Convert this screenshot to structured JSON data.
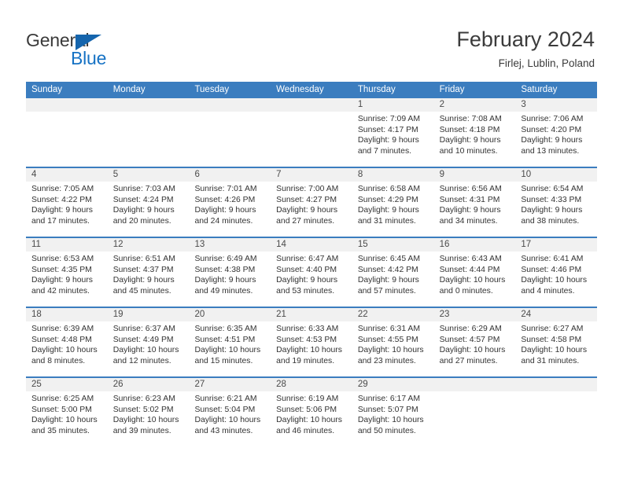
{
  "brand": {
    "name_top": "General",
    "name_bottom": "Blue",
    "accent_color": "#1672c4",
    "triangle_color": "#1565ad"
  },
  "header": {
    "title": "February 2024",
    "subtitle": "Firlej, Lublin, Poland"
  },
  "theme": {
    "header_blue": "#3b7dbf",
    "day_band_gray": "#f1f1f1",
    "text_color": "#333333"
  },
  "weekdays": [
    "Sunday",
    "Monday",
    "Tuesday",
    "Wednesday",
    "Thursday",
    "Friday",
    "Saturday"
  ],
  "weeks": [
    [
      {
        "day": "",
        "lines": []
      },
      {
        "day": "",
        "lines": []
      },
      {
        "day": "",
        "lines": []
      },
      {
        "day": "",
        "lines": []
      },
      {
        "day": "1",
        "lines": [
          "Sunrise: 7:09 AM",
          "Sunset: 4:17 PM",
          "Daylight: 9 hours",
          "and 7 minutes."
        ]
      },
      {
        "day": "2",
        "lines": [
          "Sunrise: 7:08 AM",
          "Sunset: 4:18 PM",
          "Daylight: 9 hours",
          "and 10 minutes."
        ]
      },
      {
        "day": "3",
        "lines": [
          "Sunrise: 7:06 AM",
          "Sunset: 4:20 PM",
          "Daylight: 9 hours",
          "and 13 minutes."
        ]
      }
    ],
    [
      {
        "day": "4",
        "lines": [
          "Sunrise: 7:05 AM",
          "Sunset: 4:22 PM",
          "Daylight: 9 hours",
          "and 17 minutes."
        ]
      },
      {
        "day": "5",
        "lines": [
          "Sunrise: 7:03 AM",
          "Sunset: 4:24 PM",
          "Daylight: 9 hours",
          "and 20 minutes."
        ]
      },
      {
        "day": "6",
        "lines": [
          "Sunrise: 7:01 AM",
          "Sunset: 4:26 PM",
          "Daylight: 9 hours",
          "and 24 minutes."
        ]
      },
      {
        "day": "7",
        "lines": [
          "Sunrise: 7:00 AM",
          "Sunset: 4:27 PM",
          "Daylight: 9 hours",
          "and 27 minutes."
        ]
      },
      {
        "day": "8",
        "lines": [
          "Sunrise: 6:58 AM",
          "Sunset: 4:29 PM",
          "Daylight: 9 hours",
          "and 31 minutes."
        ]
      },
      {
        "day": "9",
        "lines": [
          "Sunrise: 6:56 AM",
          "Sunset: 4:31 PM",
          "Daylight: 9 hours",
          "and 34 minutes."
        ]
      },
      {
        "day": "10",
        "lines": [
          "Sunrise: 6:54 AM",
          "Sunset: 4:33 PM",
          "Daylight: 9 hours",
          "and 38 minutes."
        ]
      }
    ],
    [
      {
        "day": "11",
        "lines": [
          "Sunrise: 6:53 AM",
          "Sunset: 4:35 PM",
          "Daylight: 9 hours",
          "and 42 minutes."
        ]
      },
      {
        "day": "12",
        "lines": [
          "Sunrise: 6:51 AM",
          "Sunset: 4:37 PM",
          "Daylight: 9 hours",
          "and 45 minutes."
        ]
      },
      {
        "day": "13",
        "lines": [
          "Sunrise: 6:49 AM",
          "Sunset: 4:38 PM",
          "Daylight: 9 hours",
          "and 49 minutes."
        ]
      },
      {
        "day": "14",
        "lines": [
          "Sunrise: 6:47 AM",
          "Sunset: 4:40 PM",
          "Daylight: 9 hours",
          "and 53 minutes."
        ]
      },
      {
        "day": "15",
        "lines": [
          "Sunrise: 6:45 AM",
          "Sunset: 4:42 PM",
          "Daylight: 9 hours",
          "and 57 minutes."
        ]
      },
      {
        "day": "16",
        "lines": [
          "Sunrise: 6:43 AM",
          "Sunset: 4:44 PM",
          "Daylight: 10 hours",
          "and 0 minutes."
        ]
      },
      {
        "day": "17",
        "lines": [
          "Sunrise: 6:41 AM",
          "Sunset: 4:46 PM",
          "Daylight: 10 hours",
          "and 4 minutes."
        ]
      }
    ],
    [
      {
        "day": "18",
        "lines": [
          "Sunrise: 6:39 AM",
          "Sunset: 4:48 PM",
          "Daylight: 10 hours",
          "and 8 minutes."
        ]
      },
      {
        "day": "19",
        "lines": [
          "Sunrise: 6:37 AM",
          "Sunset: 4:49 PM",
          "Daylight: 10 hours",
          "and 12 minutes."
        ]
      },
      {
        "day": "20",
        "lines": [
          "Sunrise: 6:35 AM",
          "Sunset: 4:51 PM",
          "Daylight: 10 hours",
          "and 15 minutes."
        ]
      },
      {
        "day": "21",
        "lines": [
          "Sunrise: 6:33 AM",
          "Sunset: 4:53 PM",
          "Daylight: 10 hours",
          "and 19 minutes."
        ]
      },
      {
        "day": "22",
        "lines": [
          "Sunrise: 6:31 AM",
          "Sunset: 4:55 PM",
          "Daylight: 10 hours",
          "and 23 minutes."
        ]
      },
      {
        "day": "23",
        "lines": [
          "Sunrise: 6:29 AM",
          "Sunset: 4:57 PM",
          "Daylight: 10 hours",
          "and 27 minutes."
        ]
      },
      {
        "day": "24",
        "lines": [
          "Sunrise: 6:27 AM",
          "Sunset: 4:58 PM",
          "Daylight: 10 hours",
          "and 31 minutes."
        ]
      }
    ],
    [
      {
        "day": "25",
        "lines": [
          "Sunrise: 6:25 AM",
          "Sunset: 5:00 PM",
          "Daylight: 10 hours",
          "and 35 minutes."
        ]
      },
      {
        "day": "26",
        "lines": [
          "Sunrise: 6:23 AM",
          "Sunset: 5:02 PM",
          "Daylight: 10 hours",
          "and 39 minutes."
        ]
      },
      {
        "day": "27",
        "lines": [
          "Sunrise: 6:21 AM",
          "Sunset: 5:04 PM",
          "Daylight: 10 hours",
          "and 43 minutes."
        ]
      },
      {
        "day": "28",
        "lines": [
          "Sunrise: 6:19 AM",
          "Sunset: 5:06 PM",
          "Daylight: 10 hours",
          "and 46 minutes."
        ]
      },
      {
        "day": "29",
        "lines": [
          "Sunrise: 6:17 AM",
          "Sunset: 5:07 PM",
          "Daylight: 10 hours",
          "and 50 minutes."
        ]
      },
      {
        "day": "",
        "lines": []
      },
      {
        "day": "",
        "lines": []
      }
    ]
  ]
}
